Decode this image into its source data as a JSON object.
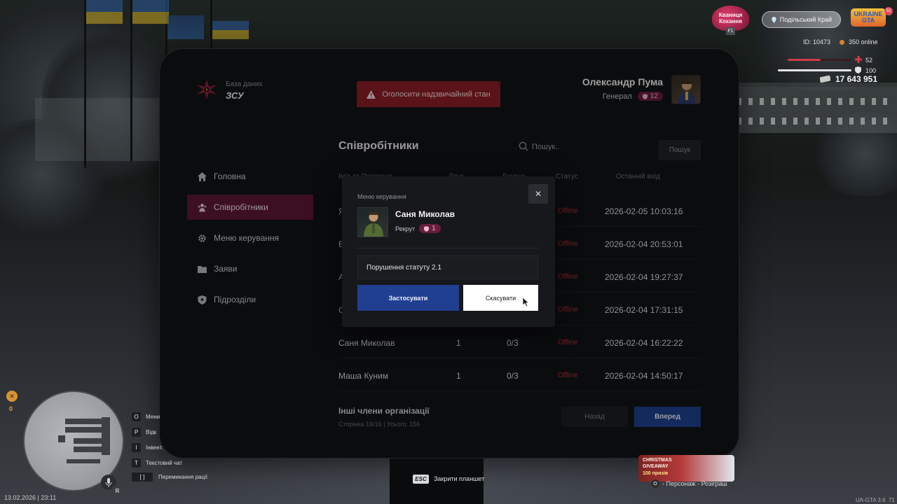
{
  "hud": {
    "event_logo_text": "Кваниця Кохання",
    "event_key": "F1",
    "server_name": "Подільський Край",
    "game_logo_text": "UKRAINE GTA",
    "game_badge": "52",
    "player_id": "ID: 10473",
    "online": "350 online",
    "health_value": "52",
    "armor_value": "100",
    "money": "17 643 951",
    "xp_value": "0",
    "mic_label": "Я",
    "datetime": "13.02.2026 | 23:11",
    "version": "UA-GTA 3.6",
    "version_extra": "71",
    "esc_key": "ESC",
    "esc_label": "Закрити планшет",
    "promo_line1": "CHRISTMAS",
    "promo_line2": "GIVEAWAY",
    "promo_line3": "100 призів",
    "promo_key": "O",
    "promo_label": "- Персонаж - Розіграш",
    "keyhints": [
      {
        "key": "O",
        "label": "Мени"
      },
      {
        "key": "P",
        "label": "Відк"
      },
      {
        "key": "I",
        "label": "Інвент."
      },
      {
        "key": "T",
        "label": "Текстовий чат"
      },
      {
        "key": "[ ]",
        "label": "Перемикання рації"
      }
    ],
    "health_percent": 52,
    "armor_percent": 100,
    "colors": {
      "health": "#d23a48",
      "armor": "#e4e5e7"
    }
  },
  "tablet": {
    "logo_subtitle": "База даних",
    "logo_title": "ЗСУ",
    "alert_button": "Оголосити надзвичайний стан",
    "user": {
      "name": "Олександр Пума",
      "rank": "Генерал",
      "rank_level": "12"
    },
    "nav": [
      {
        "label": "Головна",
        "icon": "home-icon",
        "active": false
      },
      {
        "label": "Співробітники",
        "icon": "people-icon",
        "active": true
      },
      {
        "label": "Меню керування",
        "icon": "gear-icon",
        "active": false
      },
      {
        "label": "Заяви",
        "icon": "folder-icon",
        "active": false
      },
      {
        "label": "Підрозділи",
        "icon": "shield-icon",
        "active": false
      }
    ],
    "section_title": "Співробітники",
    "search": {
      "placeholder": "Пошук..",
      "button": "Пошук"
    },
    "columns": [
      "Ім'я та Прізвище",
      "Ранг",
      "Догани",
      "Статус",
      "Останній вхід"
    ],
    "rows": [
      {
        "name": "Я",
        "rank": "",
        "warns": "",
        "status": "Offline",
        "last_login": "2026-02-05 10:03:16"
      },
      {
        "name": "Е",
        "rank": "",
        "warns": "",
        "status": "Offline",
        "last_login": "2026-02-04 20:53:01"
      },
      {
        "name": "А",
        "rank": "",
        "warns": "",
        "status": "Offline",
        "last_login": "2026-02-04 19:27:37"
      },
      {
        "name": "С",
        "rank": "",
        "warns": "",
        "status": "Offline",
        "last_login": "2026-02-04 17:31:15"
      },
      {
        "name": "Саня Миколав",
        "rank": "1",
        "warns": "0/3",
        "status": "Offline",
        "last_login": "2026-02-04 16:22:22"
      },
      {
        "name": "Маша Куним",
        "rank": "1",
        "warns": "0/3",
        "status": "Offline",
        "last_login": "2026-02-04 14:50:17"
      }
    ],
    "footer": {
      "title": "Інші члени організації",
      "subtitle": "Сторінка 16/16 | Усього: 156"
    },
    "pagination": {
      "prev": "Назад",
      "next": "Вперед"
    },
    "colors": {
      "accent": "#5c1834",
      "primary": "#213f91",
      "danger": "#8a1e25",
      "offline": "#b62e3a"
    }
  },
  "modal": {
    "title": "Меню керування",
    "close": "✕",
    "member_name": "Саня Миколав",
    "member_rank": "Рекрут",
    "member_rank_level": "1",
    "reason_value": "Порушення статуту 2.1",
    "apply_button": "Застосувати",
    "cancel_button": "Скасувати"
  }
}
